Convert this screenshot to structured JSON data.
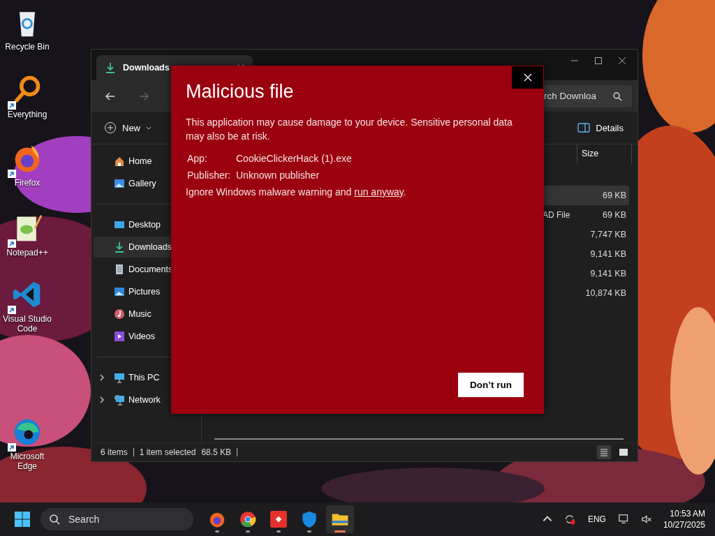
{
  "desktop_icons": [
    {
      "label": "Recycle Bin",
      "shortcut": false
    },
    {
      "label": "Everything",
      "shortcut": true
    },
    {
      "label": "Firefox",
      "shortcut": true
    },
    {
      "label": "Notepad++",
      "shortcut": true
    },
    {
      "label": "Visual Studio Code",
      "shortcut": true
    },
    {
      "label": "Microsoft Edge",
      "shortcut": true
    }
  ],
  "explorer": {
    "tab": {
      "label": "Downloads"
    },
    "search": {
      "placeholder": "rch Downloa"
    },
    "toolbar": {
      "new_button": "New",
      "details_button": "Details"
    },
    "sidebar": {
      "groups": [
        [
          {
            "label": "Home",
            "selected": false
          },
          {
            "label": "Gallery",
            "selected": false
          }
        ],
        [
          {
            "label": "Desktop",
            "selected": false
          },
          {
            "label": "Downloads",
            "selected": true
          },
          {
            "label": "Documents",
            "selected": false
          },
          {
            "label": "Pictures",
            "selected": false
          },
          {
            "label": "Music",
            "selected": false
          },
          {
            "label": "Videos",
            "selected": false
          }
        ],
        [
          {
            "label": "This PC",
            "selected": false,
            "expanded": false
          },
          {
            "label": "Network",
            "selected": false,
            "expanded": false
          }
        ]
      ]
    },
    "columns": [
      "Size"
    ],
    "rows": [
      {
        "size": "69 KB",
        "selected": true
      },
      {
        "type": "AD File",
        "size": "69 KB",
        "selected": false
      },
      {
        "size": "7,747 KB",
        "selected": false
      },
      {
        "size": "9,141 KB",
        "selected": false
      },
      {
        "size": "9,141 KB",
        "selected": false
      },
      {
        "size": "10,874 KB",
        "selected": false
      }
    ],
    "status_bar": {
      "item_count": "6 items",
      "selection": "1 item selected",
      "selection_size": "68.5 KB"
    }
  },
  "dialog": {
    "title": "Malicious file",
    "message": "This application may cause damage to your device. Sensitive personal data may also be at risk.",
    "fields": [
      {
        "label": "App:",
        "value": "CookieClickerHack (1).exe"
      },
      {
        "label": "Publisher:",
        "value": "Unknown publisher"
      }
    ],
    "bypass": {
      "before": "Ignore Windows malware warning and",
      "link": "run anyway",
      "after": "."
    },
    "button": "Don’t run"
  },
  "taskbar": {
    "search": {
      "placeholder": "Search"
    },
    "apps": [
      {
        "selected": false
      },
      {
        "selected": false
      },
      {
        "selected": false
      },
      {
        "selected": false
      },
      {
        "selected": true
      }
    ],
    "language": "ENG",
    "time": "10:53 AM",
    "date": "10/27/2025"
  }
}
